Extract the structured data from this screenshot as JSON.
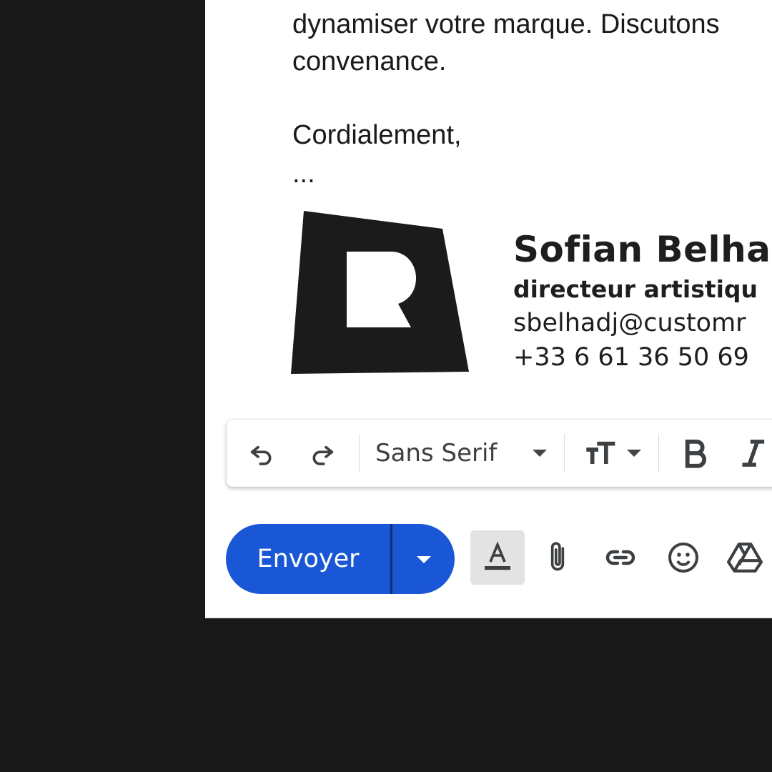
{
  "email_body": {
    "lines": [
      "dynamiser votre marque. Discutons",
      "convenance.",
      "Cordialement,",
      "..."
    ]
  },
  "signature": {
    "name": "Sofian Belha",
    "role": "directeur artistiqu",
    "email": "sbelhadj@customr",
    "phone": "+33 6 61 36 50 69",
    "logo_letter": "R"
  },
  "toolbar": {
    "font_family": "Sans Serif",
    "icons": [
      "undo-icon",
      "redo-icon",
      "text-size-icon",
      "bold-icon",
      "italic-icon"
    ]
  },
  "actions": {
    "send_label": "Envoyer",
    "icons": [
      "text-format-icon",
      "attach-icon",
      "link-icon",
      "emoji-icon",
      "drive-icon"
    ]
  },
  "colors": {
    "background": "#181818",
    "send_button": "#1a57d6",
    "text": "#1a1a1a"
  }
}
